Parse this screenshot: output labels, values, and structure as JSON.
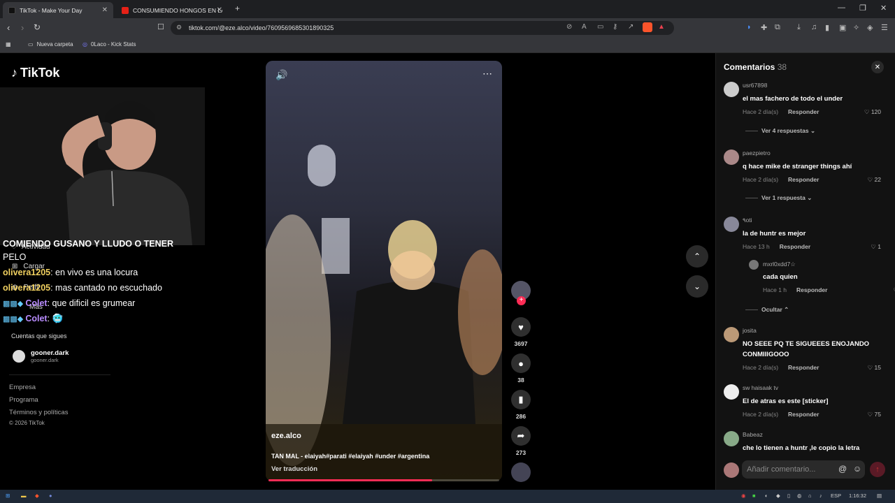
{
  "browser": {
    "tabs": [
      {
        "title": "TikTok - Make Your Day",
        "active": true
      },
      {
        "title": "CONSUMIENDO HONGOS EN LAS SI",
        "active": false
      }
    ],
    "new_tab": "+",
    "url": "tiktok.com/@eze.alco/video/7609569685301890325",
    "bookmarks": [
      {
        "label": "Nueva carpeta",
        "icon": "folder-icon"
      },
      {
        "label": "0Laco - Kick Stats",
        "icon": "kick-icon"
      }
    ]
  },
  "tiktok": {
    "logo": "TikTok",
    "sidebar": {
      "activity": "Actividad",
      "upload": "Cargar",
      "profile": "Perfil",
      "more": "Más",
      "following_title": "Cuentas que sigues",
      "following": [
        {
          "name": "gooner.dark",
          "handle": "gooner.dark"
        }
      ],
      "footer": [
        "Empresa",
        "Programa",
        "Términos y políticas",
        "© 2026 TikTok"
      ]
    },
    "video": {
      "handle": "eze.alco",
      "caption": "TAN MAL - elaiyah#parati #elaiyah #under #argentina",
      "translate": "Ver traducción",
      "progress": 0.71,
      "likes": "3697",
      "comments": "38",
      "saves": "286",
      "shares": "273"
    },
    "comments_panel": {
      "title": "Comentarios",
      "count": "38",
      "reply_label": "Responder",
      "items": [
        {
          "user": "usr67898",
          "text": "el mas fachero de todo el under",
          "time": "Hace 2 día(s)",
          "likes": "120",
          "replies": "Ver 4 respuestas"
        },
        {
          "user": "paezpietro",
          "text": "q hace mike de stranger things ahí",
          "time": "Hace 2 día(s)",
          "likes": "22",
          "replies": "Ver 1 respuesta"
        },
        {
          "user": "٩oti",
          "text": "la de huntr es mejor",
          "time": "Hace 13 h",
          "likes": "1"
        },
        {
          "user": "mxrl0xdd7☆",
          "text": "cada quien",
          "time": "Hace 1 h",
          "likes": "0",
          "replies": "Ocultar"
        },
        {
          "user": "josita",
          "text": "NO SEEE PQ TE SIGUEEES ENOJANDO CONMIIIGOOO",
          "time": "Hace 2 día(s)",
          "likes": "15"
        },
        {
          "user": "sw haisaak tv",
          "text": "El de atras es este [sticker]",
          "time": "Hace 2 día(s)",
          "likes": "75"
        },
        {
          "user": "Babeaz",
          "text": "che lo tienen a huntr ,le copio la letra"
        }
      ],
      "input_placeholder": "Añadir comentario..."
    }
  },
  "stream_chat": {
    "top_partial": "COMIENDO GUSANO Y LLUDO O TENER",
    "top_partial2": "PELO",
    "messages": [
      {
        "user": "olivera1205",
        "text": ": en vivo es una locura"
      },
      {
        "user": "olivera1205",
        "text": ": mas cantado no escuchado"
      },
      {
        "user": "Colet",
        "text": ": que dificil es grumear"
      },
      {
        "user": "Colet",
        "text": ": 🥶"
      }
    ]
  },
  "taskbar": {
    "lang": "ESP",
    "time": "1:16:32"
  }
}
